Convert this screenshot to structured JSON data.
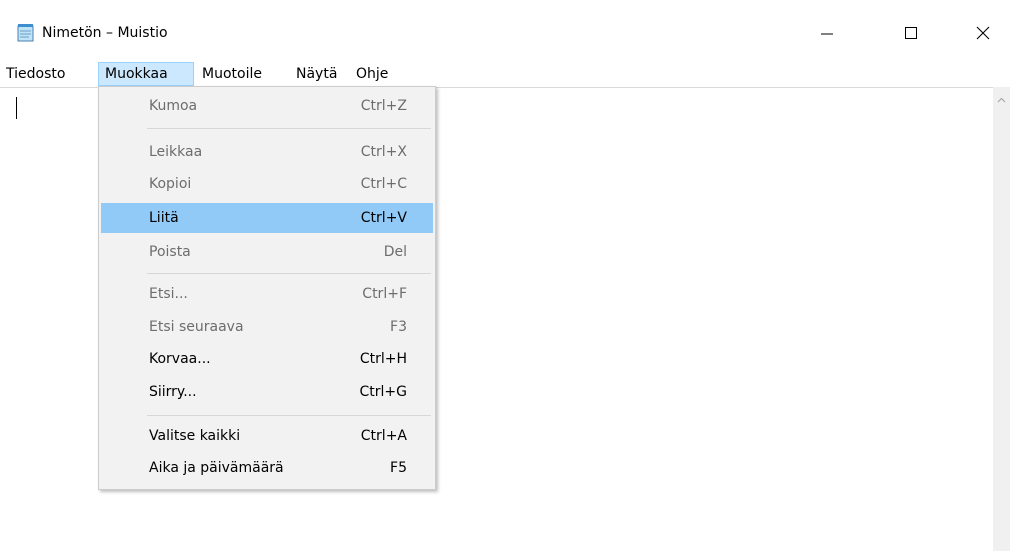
{
  "window": {
    "title": "Nimetön – Muistio"
  },
  "menubar": {
    "items": [
      {
        "label": "Tiedosto"
      },
      {
        "label": "Muokkaa"
      },
      {
        "label": "Muotoile"
      },
      {
        "label": "Näytä"
      },
      {
        "label": "Ohje"
      }
    ]
  },
  "edit_menu": {
    "items": [
      {
        "label": "Kumoa",
        "shortcut": "Ctrl+Z",
        "enabled": false
      },
      {
        "label": "Leikkaa",
        "shortcut": "Ctrl+X",
        "enabled": false
      },
      {
        "label": "Kopioi",
        "shortcut": "Ctrl+C",
        "enabled": false
      },
      {
        "label": "Liitä",
        "shortcut": "Ctrl+V",
        "enabled": true,
        "highlighted": true
      },
      {
        "label": "Poista",
        "shortcut": "Del",
        "enabled": false
      },
      {
        "label": "Etsi...",
        "shortcut": "Ctrl+F",
        "enabled": false
      },
      {
        "label": "Etsi seuraava",
        "shortcut": "F3",
        "enabled": false
      },
      {
        "label": "Korvaa...",
        "shortcut": "Ctrl+H",
        "enabled": true
      },
      {
        "label": "Siirry...",
        "shortcut": "Ctrl+G",
        "enabled": true
      },
      {
        "label": "Valitse kaikki",
        "shortcut": "Ctrl+A",
        "enabled": true
      },
      {
        "label": "Aika ja päivämäärä",
        "shortcut": "F5",
        "enabled": true
      }
    ]
  },
  "icons": {
    "app": "notepad-icon",
    "minimize": "minimize-icon",
    "maximize": "maximize-icon",
    "close": "close-icon",
    "scroll_up": "chevron-up-icon"
  },
  "colors": {
    "menu_highlight": "#91c9f7",
    "menubar_active": "#cce8ff",
    "dropdown_bg": "#f2f2f2"
  }
}
